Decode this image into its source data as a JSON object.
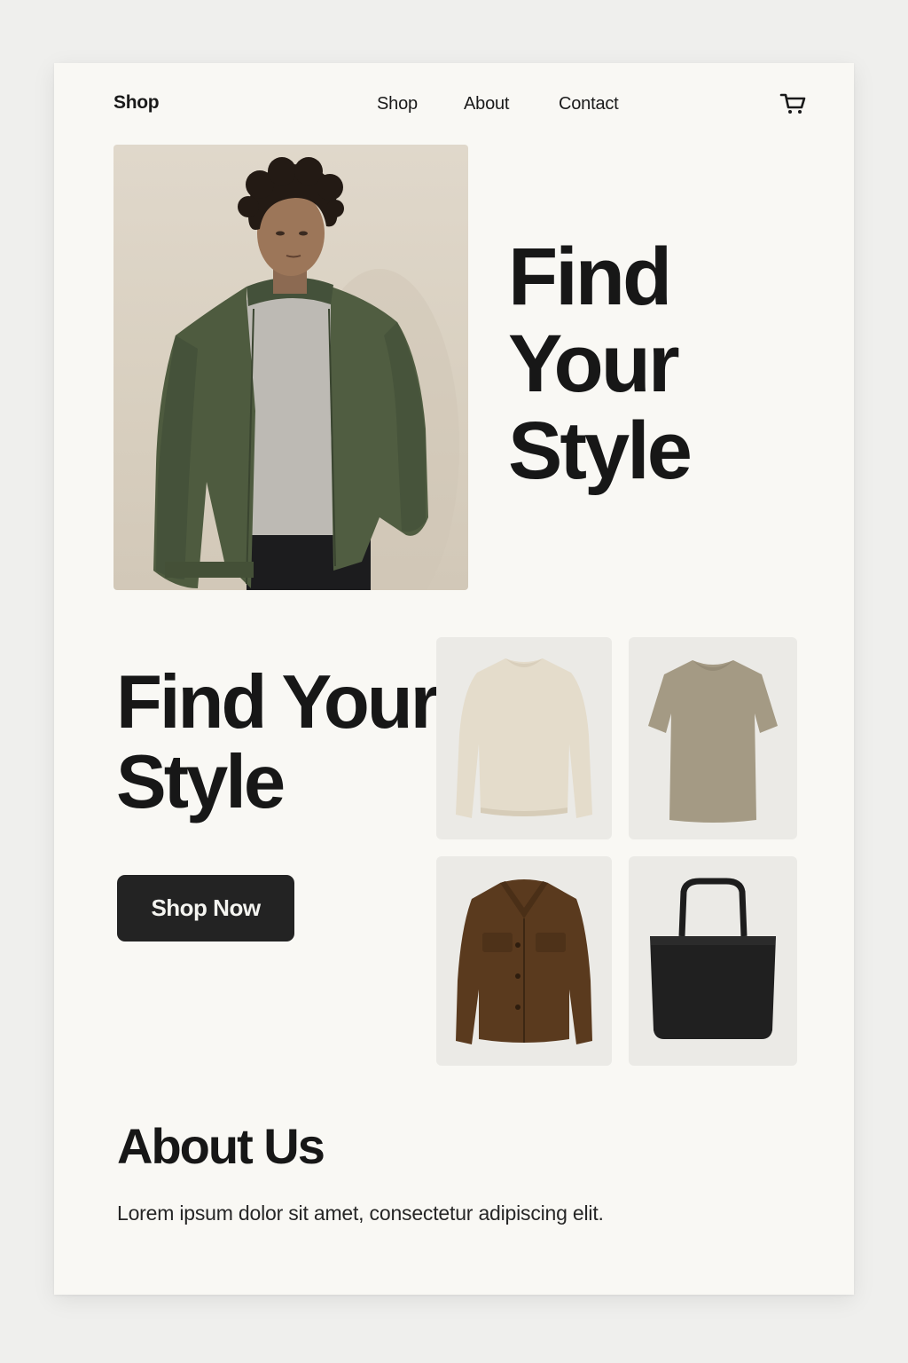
{
  "header": {
    "brand": "Shop",
    "nav": [
      "Shop",
      "About",
      "Contact"
    ],
    "cart_icon": "cart-icon"
  },
  "hero": {
    "image": "model-in-green-bomber-jacket",
    "title_lines": [
      "Find",
      "Your",
      "Style"
    ]
  },
  "featured": {
    "title_lines": [
      "Find Your",
      "Style"
    ],
    "cta": "Shop Now",
    "products": [
      {
        "image": "cream-knit-sweater"
      },
      {
        "image": "taupe-knit-tee"
      },
      {
        "image": "brown-suede-jacket"
      },
      {
        "image": "black-leather-tote"
      }
    ]
  },
  "about": {
    "title": "About Us",
    "text": "Lorem ipsum dolor sit amet, consectetur adipiscing elit."
  },
  "colors": {
    "page_bg": "#f9f8f4",
    "button_bg": "#232323",
    "text": "#171717"
  }
}
